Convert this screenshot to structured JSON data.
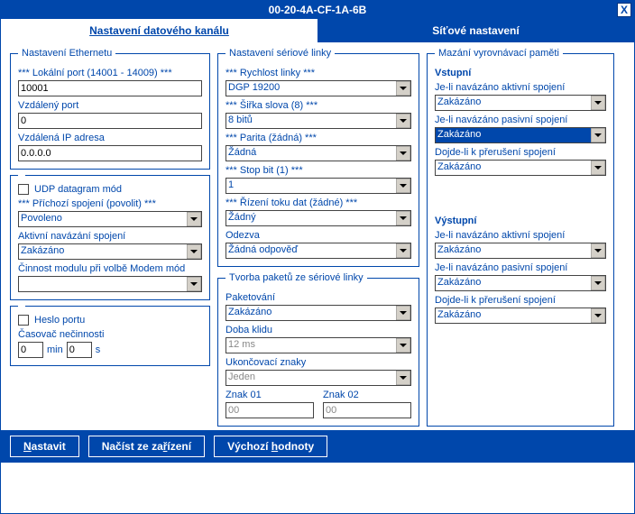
{
  "title": "00-20-4A-CF-1A-6B",
  "tabs": {
    "data": "Nastavení datového kanálu",
    "net": "Síťové nastavení"
  },
  "ethernet": {
    "legend": "Nastavení Ethernetu",
    "local_port_label": "*** Lokální port (14001 - 14009) ***",
    "local_port": "10001",
    "remote_port_label": "Vzdálený port",
    "remote_port": "0",
    "remote_ip_label": "Vzdálená IP adresa",
    "remote_ip": "0.0.0.0",
    "udp_label": "UDP datagram mód",
    "incoming_label": "*** Příchozí spojení (povolit) ***",
    "incoming": "Povoleno",
    "active_label": "Aktivní navázání spojení",
    "active": "Zakázáno",
    "modem_label": "Činnost modulu při volbě Modem mód",
    "modem": "",
    "port_pw_label": "Heslo portu",
    "idle_label": "Časovač nečinnosti",
    "idle_min": "0",
    "idle_min_unit": "min",
    "idle_sec": "0",
    "idle_sec_unit": "s"
  },
  "serial": {
    "legend": "Nastavení sériové linky",
    "speed_label": "*** Rychlost linky ***",
    "speed": "DGP 19200",
    "width_label": "*** Šiřka slova (8) ***",
    "width": "8 bitů",
    "parity_label": "*** Parita (žádná) ***",
    "parity": "Žádná",
    "stop_label": "*** Stop bit (1) ***",
    "stop": "1",
    "flow_label": "*** Řízení toku dat (žádné) ***",
    "flow": "Žádný",
    "response_label": "Odezva",
    "response": "Žádná odpověď"
  },
  "packet": {
    "legend": "Tvorba paketů ze sériové linky",
    "pk_label": "Paketování",
    "pk": "Zakázáno",
    "idle_label": "Doba klidu",
    "idle": "12 ms",
    "end_label": "Ukončovací znaky",
    "end": "Jeden",
    "c1_label": "Znak 01",
    "c1": "00",
    "c2_label": "Znak 02",
    "c2": "00"
  },
  "flush": {
    "legend": "Mazání vyrovnávací paměti",
    "in_heading": "Vstupní",
    "out_heading": "Výstupní",
    "active_label": "Je-li navázáno aktivní spojení",
    "passive_label": "Je-li navázáno pasivní spojení",
    "break_label": "Dojde-li k přerušení spojení",
    "in_active": "Zakázáno",
    "in_passive": "Zakázáno",
    "in_break": "Zakázáno",
    "out_active": "Zakázáno",
    "out_passive": "Zakázáno",
    "out_break": "Zakázáno"
  },
  "buttons": {
    "set_pre": "N",
    "set_rest": "astavit",
    "read_pre": "Načíst ze za",
    "read_u": "ř",
    "read_post": "ízení",
    "def_pre": "Výchozí ",
    "def_u": "h",
    "def_post": "odnoty"
  },
  "close": "X"
}
